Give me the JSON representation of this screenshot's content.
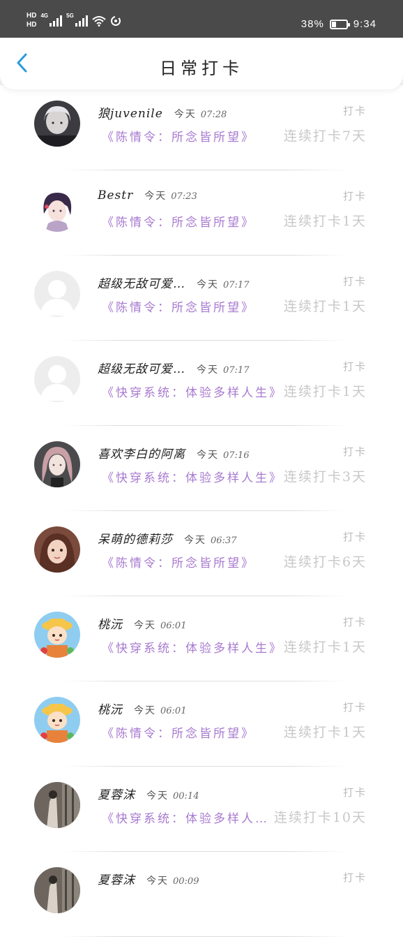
{
  "status_bar": {
    "hd1": "HD",
    "hd2": "HD",
    "net1": "4G",
    "net2": "5G",
    "battery_percent": "38%",
    "battery_level": 0.38,
    "time": "9:34",
    "icons": [
      "signal-icon",
      "signal-icon",
      "wifi-icon",
      "sync-icon",
      "battery-icon"
    ]
  },
  "header": {
    "title": "日常打卡",
    "back_icon": "chevron-left-icon",
    "accent_color": "#2b9bdc"
  },
  "items": [
    {
      "name": "狼juvenile",
      "date": "今天",
      "time": "07:28",
      "tag": "打卡",
      "book": "《陈情令：所念皆所望》",
      "streak": "连续打卡7天",
      "avatar": "avatar-dark-hair"
    },
    {
      "name": "Bestr",
      "date": "今天",
      "time": "07:23",
      "tag": "打卡",
      "book": "《陈情令：所念皆所望》",
      "streak": "连续打卡1天",
      "avatar": "avatar-anime"
    },
    {
      "name": "超级无敌可爱…",
      "date": "今天",
      "time": "07:17",
      "tag": "打卡",
      "book": "《陈情令：所念皆所望》",
      "streak": "连续打卡1天",
      "avatar": "avatar-default"
    },
    {
      "name": "超级无敌可爱…",
      "date": "今天",
      "time": "07:17",
      "tag": "打卡",
      "book": "《快穿系统：体验多样人生》",
      "streak": "连续打卡1天",
      "avatar": "avatar-default"
    },
    {
      "name": "喜欢李白的阿离",
      "date": "今天",
      "time": "07:16",
      "tag": "打卡",
      "book": "《快穿系统：体验多样人生》",
      "streak": "连续打卡3天",
      "avatar": "avatar-pink-hair"
    },
    {
      "name": "呆萌的德莉莎",
      "date": "今天",
      "time": "06:37",
      "tag": "打卡",
      "book": "《陈情令：所念皆所望》",
      "streak": "连续打卡6天",
      "avatar": "avatar-photo-girl"
    },
    {
      "name": "桃沅",
      "date": "今天",
      "time": "06:01",
      "tag": "打卡",
      "book": "《快穿系统：体验多样人生》",
      "streak": "连续打卡1天",
      "avatar": "avatar-cartoon"
    },
    {
      "name": "桃沅",
      "date": "今天",
      "time": "06:01",
      "tag": "打卡",
      "book": "《陈情令：所念皆所望》",
      "streak": "连续打卡1天",
      "avatar": "avatar-cartoon"
    },
    {
      "name": "夏蓉沫",
      "date": "今天",
      "time": "00:14",
      "tag": "打卡",
      "book": "《快穿系统：体验多样人…",
      "streak": "连续打卡10天",
      "avatar": "avatar-room"
    },
    {
      "name": "夏蓉沫",
      "date": "今天",
      "time": "00:09",
      "tag": "打卡",
      "book": "",
      "streak": "",
      "avatar": "avatar-room"
    }
  ]
}
